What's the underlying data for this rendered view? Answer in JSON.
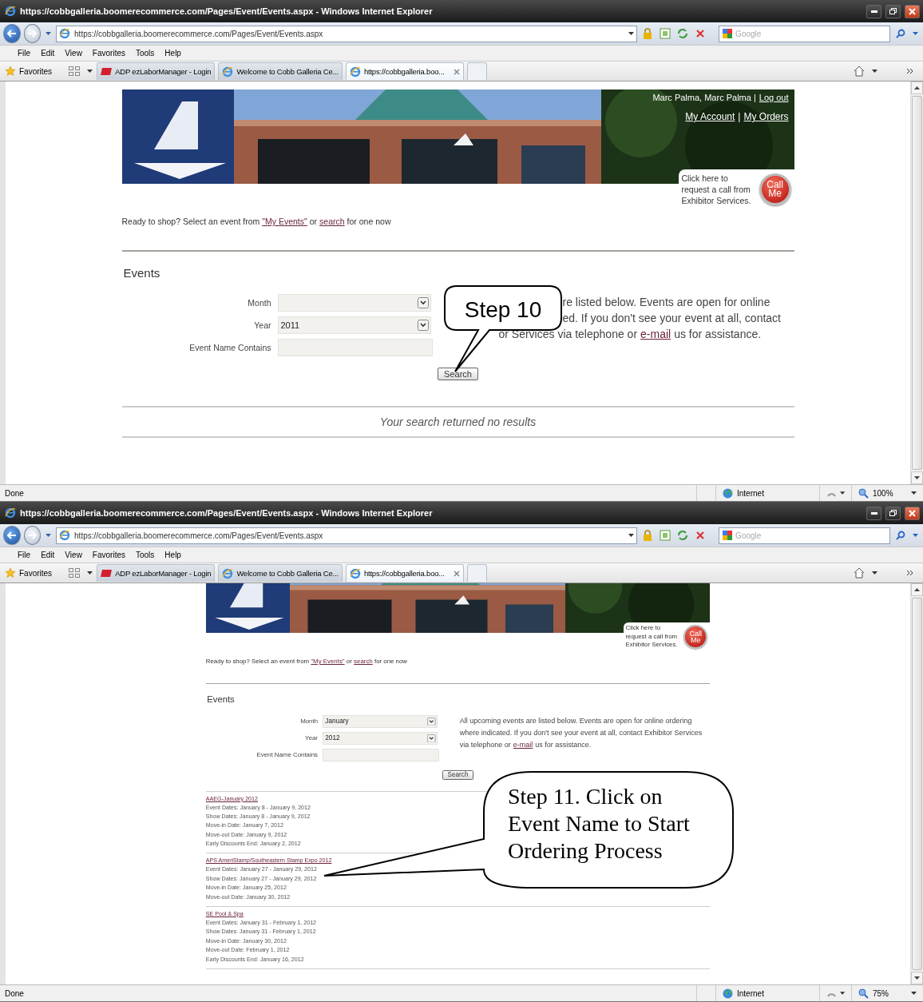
{
  "windows": [
    {
      "title": "https://cobbgalleria.boomerecommerce.com/Pages/Event/Events.aspx - Windows Internet Explorer",
      "address": "https://cobbgalleria.boomerecommerce.com/Pages/Event/Events.aspx",
      "search_placeholder": "Google",
      "menu": [
        "File",
        "Edit",
        "View",
        "Favorites",
        "Tools",
        "Help"
      ],
      "favorites": "Favorites",
      "tabs": [
        {
          "label": "ADP ezLaborManager - Login",
          "kind": "adp",
          "selected": false
        },
        {
          "label": "Welcome to Cobb Galleria Ce...",
          "kind": "ie",
          "selected": false
        },
        {
          "label": "https://cobbgalleria.boo...",
          "kind": "ie",
          "selected": true
        }
      ],
      "status": "Done",
      "zone": "Internet",
      "zoom": "100%",
      "page": {
        "header": {
          "user": "Marc Palma, Marc Palma |",
          "logout": "Log out",
          "links": [
            "My Account",
            "My Orders"
          ],
          "separator": "|",
          "call_text": "Click here to request a call from Exhibitor Services.",
          "call_button": "Call Me"
        },
        "intro": {
          "before": "Ready to shop? Select an event from",
          "link1": "\"My Events\"",
          "middle": "or",
          "link2": "search",
          "after": "for one now"
        },
        "title": "Events",
        "fields": [
          {
            "label": "Month",
            "kind": "select"
          },
          {
            "label": "Year",
            "kind": "select",
            "value": "2011"
          },
          {
            "label": "Event Name Contains",
            "kind": "text"
          }
        ],
        "info": [
          {
            "text": "re listed below. Events are open for online"
          },
          {
            "text": "ed. If you don't see your event at all, contact"
          },
          {
            "text": "or Services via telephone or",
            "link": "e-mail",
            "after": "us for assistance."
          }
        ],
        "search": "Search",
        "results": {
          "message": "Your search returned no results"
        }
      },
      "callout": {
        "lines": [
          "Step 10"
        ]
      }
    },
    {
      "title": "https://cobbgalleria.boomerecommerce.com/Pages/Event/Events.aspx - Windows Internet Explorer",
      "address": "https://cobbgalleria.boomerecommerce.com/Pages/Event/Events.aspx",
      "search_placeholder": "Google",
      "menu": [
        "File",
        "Edit",
        "View",
        "Favorites",
        "Tools",
        "Help"
      ],
      "favorites": "Favorites",
      "tabs": [
        {
          "label": "ADP ezLaborManager - Login",
          "kind": "adp",
          "selected": false
        },
        {
          "label": "Welcome to Cobb Galleria Ce...",
          "kind": "ie",
          "selected": false
        },
        {
          "label": "https://cobbgalleria.boo...",
          "kind": "ie",
          "selected": true
        }
      ],
      "status": "Done",
      "zone": "Internet",
      "zoom": "75%",
      "page": {
        "header": {
          "call_text": "Click here to request a call from Exhibitor Services.",
          "call_button": "Call Me"
        },
        "intro": {
          "before": "Ready to shop? Select an event from",
          "link1": "\"My Events\"",
          "middle": "or",
          "link2": "search",
          "after": "for one now"
        },
        "title": "Events",
        "fields": [
          {
            "label": "Month",
            "kind": "select",
            "value": "January"
          },
          {
            "label": "Year",
            "kind": "select",
            "value": "2012"
          },
          {
            "label": "Event Name Contains",
            "kind": "text"
          }
        ],
        "info": [
          {
            "text": "All upcoming events are listed below. Events are open for online ordering"
          },
          {
            "text": "where indicated. If you don't see your event at all, contact Exhibitor Services"
          },
          {
            "text": "via telephone or",
            "link": "e-mail",
            "after": "us for assistance."
          }
        ],
        "search": "Search",
        "results": {
          "events": [
            {
              "name": "AAEG-January 2012",
              "details": [
                "Event Dates: January 8 - January 9, 2012",
                "Show Dates: January 8 - January 9, 2012",
                "Move-in Date: January 7, 2012",
                "Move-out Date: January 9, 2012",
                "Early Discounts End: January 2, 2012"
              ]
            },
            {
              "name": "APS AmeriStamp/Southeastern Stamp Expo 2012",
              "details": [
                "Event Dates: January 27 - January 29, 2012",
                "Show Dates: January 27 - January 29, 2012",
                "Move-in Date: January 25, 2012",
                "Move-out Date: January 30, 2012"
              ]
            },
            {
              "name": "SE Pool & Spa",
              "details": [
                "Event Dates: January 31 - February 1, 2012",
                "Show Dates: January 31 - February 1, 2012",
                "Move-in Date: January 30, 2012",
                "Move-out Date: February 1, 2012",
                "Early Discounts End: January 16, 2012"
              ]
            }
          ]
        }
      },
      "callout": {
        "lines": [
          "Step 11. Click on",
          "Event Name to Start",
          "Ordering Process"
        ]
      }
    }
  ]
}
